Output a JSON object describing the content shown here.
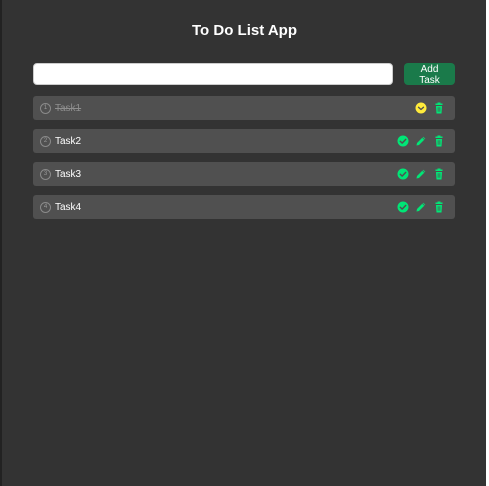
{
  "app": {
    "title": "To Do List App"
  },
  "input": {
    "value": "",
    "placeholder": ""
  },
  "add_button": {
    "label": "Add Task"
  },
  "tasks": [
    {
      "number": "1",
      "text": "Task1",
      "completed": true
    },
    {
      "number": "2",
      "text": "Task2",
      "completed": false
    },
    {
      "number": "3",
      "text": "Task3",
      "completed": false
    },
    {
      "number": "4",
      "text": "Task4",
      "completed": false
    }
  ],
  "colors": {
    "background": "#333333",
    "task_row": "#505050",
    "add_button": "#1a7a4a",
    "action_icon": "#00e676",
    "completed_icon": "#ffeb3b",
    "completed_text": "#8e8e8e"
  },
  "icons": {
    "complete": "check-circle-icon",
    "completed": "check-circle-icon",
    "edit": "pencil-icon",
    "delete": "trash-icon"
  }
}
